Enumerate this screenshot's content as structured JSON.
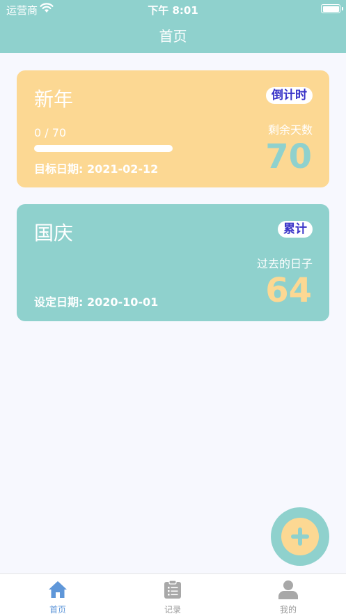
{
  "status_bar": {
    "carrier": "运营商",
    "time": "下午 8:01"
  },
  "header": {
    "title": "首页"
  },
  "cards": [
    {
      "title": "新年",
      "tag": "倒计时",
      "progress_text": "0 / 70",
      "progress_fraction": 0,
      "date_line": "目标日期: 2021-02-12",
      "count_label": "剩余天数",
      "count_value": "70"
    },
    {
      "title": "国庆",
      "tag": "累计",
      "date_line": "设定日期: 2020-10-01",
      "count_label": "过去的日子",
      "count_value": "64"
    }
  ],
  "fab": {
    "icon": "plus-icon"
  },
  "tabbar": {
    "items": [
      {
        "label": "首页",
        "icon": "home-icon",
        "active": true
      },
      {
        "label": "记录",
        "icon": "clipboard-icon",
        "active": false
      },
      {
        "label": "我的",
        "icon": "person-icon",
        "active": false
      }
    ]
  },
  "colors": {
    "teal": "#8fd1cd",
    "amber": "#fcd893",
    "tag_text": "#3a34c8",
    "tab_active": "#5f97d9",
    "tab_inactive": "#9a9a9a",
    "background": "#f7f8fe"
  }
}
